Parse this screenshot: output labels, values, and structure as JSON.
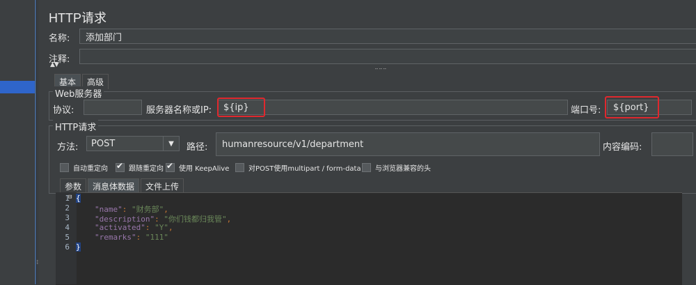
{
  "window": {
    "title": "HTTP请求"
  },
  "form": {
    "name_label": "名称:",
    "name_value": "添加部门",
    "comment_label": "注释:",
    "comment_value": ""
  },
  "tabs_main": [
    {
      "label": "基本",
      "active": true
    },
    {
      "label": "高级",
      "active": false
    }
  ],
  "web_server": {
    "group_title": "Web服务器",
    "protocol_label": "协议:",
    "protocol_value": "",
    "server_label": "服务器名称或IP:",
    "server_value": "${ip}",
    "port_label": "端口号:",
    "port_value": "${port}"
  },
  "http_request": {
    "group_title": "HTTP请求",
    "method_label": "方法:",
    "method_value": "POST",
    "path_label": "路径:",
    "path_value": "humanresource/v1/department",
    "encoding_label": "内容编码:",
    "encoding_value": ""
  },
  "options": [
    {
      "label": "自动重定向",
      "checked": false
    },
    {
      "label": "跟随重定向",
      "checked": true
    },
    {
      "label": "使用 KeepAlive",
      "checked": true
    },
    {
      "label": "对POST使用multipart / form-data",
      "checked": false
    },
    {
      "label": "与浏览器兼容的头",
      "checked": false
    }
  ],
  "tabs_body": [
    {
      "label": "参数",
      "active": false
    },
    {
      "label": "消息体数据",
      "active": true
    },
    {
      "label": "文件上传",
      "active": false
    }
  ],
  "editor": {
    "line_numbers": [
      "1",
      "2",
      "3",
      "4",
      "5",
      "6"
    ],
    "open_brace": "{",
    "close_brace": "}",
    "lines": [
      {
        "key": "\"name\"",
        "value": "\"财务部\"",
        "tail": ","
      },
      {
        "key": "\"description\"",
        "value": "\"你们钱都归我管\"",
        "tail": ","
      },
      {
        "key": "\"activated\"",
        "value": "\"Y\"",
        "tail": ","
      },
      {
        "key": "\"remarks\"",
        "value": "\"111\"",
        "tail": ""
      }
    ]
  },
  "colors": {
    "highlight": "#e0282e",
    "selection": "#2f65ca"
  }
}
